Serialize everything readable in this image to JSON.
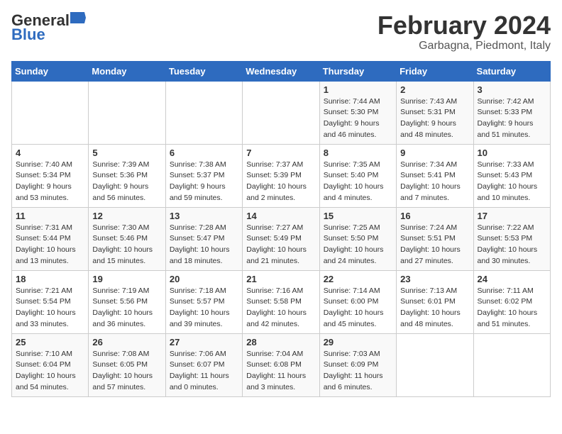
{
  "header": {
    "logo_general": "General",
    "logo_blue": "Blue",
    "month_title": "February 2024",
    "location": "Garbagna, Piedmont, Italy"
  },
  "days_of_week": [
    "Sunday",
    "Monday",
    "Tuesday",
    "Wednesday",
    "Thursday",
    "Friday",
    "Saturday"
  ],
  "weeks": [
    [
      {
        "day": "",
        "info": ""
      },
      {
        "day": "",
        "info": ""
      },
      {
        "day": "",
        "info": ""
      },
      {
        "day": "",
        "info": ""
      },
      {
        "day": "1",
        "info": "Sunrise: 7:44 AM\nSunset: 5:30 PM\nDaylight: 9 hours\nand 46 minutes."
      },
      {
        "day": "2",
        "info": "Sunrise: 7:43 AM\nSunset: 5:31 PM\nDaylight: 9 hours\nand 48 minutes."
      },
      {
        "day": "3",
        "info": "Sunrise: 7:42 AM\nSunset: 5:33 PM\nDaylight: 9 hours\nand 51 minutes."
      }
    ],
    [
      {
        "day": "4",
        "info": "Sunrise: 7:40 AM\nSunset: 5:34 PM\nDaylight: 9 hours\nand 53 minutes."
      },
      {
        "day": "5",
        "info": "Sunrise: 7:39 AM\nSunset: 5:36 PM\nDaylight: 9 hours\nand 56 minutes."
      },
      {
        "day": "6",
        "info": "Sunrise: 7:38 AM\nSunset: 5:37 PM\nDaylight: 9 hours\nand 59 minutes."
      },
      {
        "day": "7",
        "info": "Sunrise: 7:37 AM\nSunset: 5:39 PM\nDaylight: 10 hours\nand 2 minutes."
      },
      {
        "day": "8",
        "info": "Sunrise: 7:35 AM\nSunset: 5:40 PM\nDaylight: 10 hours\nand 4 minutes."
      },
      {
        "day": "9",
        "info": "Sunrise: 7:34 AM\nSunset: 5:41 PM\nDaylight: 10 hours\nand 7 minutes."
      },
      {
        "day": "10",
        "info": "Sunrise: 7:33 AM\nSunset: 5:43 PM\nDaylight: 10 hours\nand 10 minutes."
      }
    ],
    [
      {
        "day": "11",
        "info": "Sunrise: 7:31 AM\nSunset: 5:44 PM\nDaylight: 10 hours\nand 13 minutes."
      },
      {
        "day": "12",
        "info": "Sunrise: 7:30 AM\nSunset: 5:46 PM\nDaylight: 10 hours\nand 15 minutes."
      },
      {
        "day": "13",
        "info": "Sunrise: 7:28 AM\nSunset: 5:47 PM\nDaylight: 10 hours\nand 18 minutes."
      },
      {
        "day": "14",
        "info": "Sunrise: 7:27 AM\nSunset: 5:49 PM\nDaylight: 10 hours\nand 21 minutes."
      },
      {
        "day": "15",
        "info": "Sunrise: 7:25 AM\nSunset: 5:50 PM\nDaylight: 10 hours\nand 24 minutes."
      },
      {
        "day": "16",
        "info": "Sunrise: 7:24 AM\nSunset: 5:51 PM\nDaylight: 10 hours\nand 27 minutes."
      },
      {
        "day": "17",
        "info": "Sunrise: 7:22 AM\nSunset: 5:53 PM\nDaylight: 10 hours\nand 30 minutes."
      }
    ],
    [
      {
        "day": "18",
        "info": "Sunrise: 7:21 AM\nSunset: 5:54 PM\nDaylight: 10 hours\nand 33 minutes."
      },
      {
        "day": "19",
        "info": "Sunrise: 7:19 AM\nSunset: 5:56 PM\nDaylight: 10 hours\nand 36 minutes."
      },
      {
        "day": "20",
        "info": "Sunrise: 7:18 AM\nSunset: 5:57 PM\nDaylight: 10 hours\nand 39 minutes."
      },
      {
        "day": "21",
        "info": "Sunrise: 7:16 AM\nSunset: 5:58 PM\nDaylight: 10 hours\nand 42 minutes."
      },
      {
        "day": "22",
        "info": "Sunrise: 7:14 AM\nSunset: 6:00 PM\nDaylight: 10 hours\nand 45 minutes."
      },
      {
        "day": "23",
        "info": "Sunrise: 7:13 AM\nSunset: 6:01 PM\nDaylight: 10 hours\nand 48 minutes."
      },
      {
        "day": "24",
        "info": "Sunrise: 7:11 AM\nSunset: 6:02 PM\nDaylight: 10 hours\nand 51 minutes."
      }
    ],
    [
      {
        "day": "25",
        "info": "Sunrise: 7:10 AM\nSunset: 6:04 PM\nDaylight: 10 hours\nand 54 minutes."
      },
      {
        "day": "26",
        "info": "Sunrise: 7:08 AM\nSunset: 6:05 PM\nDaylight: 10 hours\nand 57 minutes."
      },
      {
        "day": "27",
        "info": "Sunrise: 7:06 AM\nSunset: 6:07 PM\nDaylight: 11 hours\nand 0 minutes."
      },
      {
        "day": "28",
        "info": "Sunrise: 7:04 AM\nSunset: 6:08 PM\nDaylight: 11 hours\nand 3 minutes."
      },
      {
        "day": "29",
        "info": "Sunrise: 7:03 AM\nSunset: 6:09 PM\nDaylight: 11 hours\nand 6 minutes."
      },
      {
        "day": "",
        "info": ""
      },
      {
        "day": "",
        "info": ""
      }
    ]
  ]
}
